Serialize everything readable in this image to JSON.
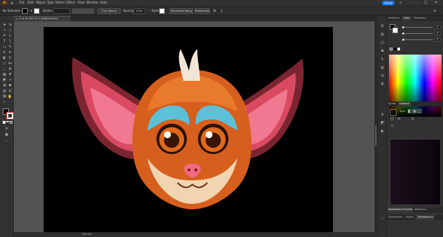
{
  "menubar": {
    "logo": "Ai",
    "items": [
      "File",
      "Edit",
      "Object",
      "Type",
      "Select",
      "Effect",
      "View",
      "Window",
      "Help"
    ],
    "share_label": "Share"
  },
  "controlbar": {
    "selection_label": "No Selection",
    "stroke_label": "Stroke:",
    "stroke_cap": "3 pt. Round",
    "opacity_label": "Opacity:",
    "opacity_value": "100%",
    "style_label": "Style:",
    "document_setup_label": "Document Setup",
    "preferences_label": "Preferences"
  },
  "document": {
    "tab_title": "*1.ai @ 106.76 % (RGB/Preview)"
  },
  "statusbar": {
    "zoom": "106.76%"
  },
  "panels": {
    "top_tabs": [
      "Swatches",
      "Color",
      "Properties"
    ],
    "active_top_tab": "Color",
    "color_values": [
      "0",
      "0",
      "0"
    ],
    "mid_tabs": [
      "Stroke",
      "Gradient"
    ],
    "active_mid_tab": "Gradient",
    "gradient_type_label": "Type:",
    "bottom_tabs_1": [
      "Separations Preview",
      "Attributes"
    ],
    "bottom_tabs_2": [
      "Appearance",
      "Layers",
      "Transparency"
    ]
  },
  "colors": {
    "accent_share": "#1473e6",
    "artboard": "#000000",
    "pasteboard": "#535353"
  }
}
